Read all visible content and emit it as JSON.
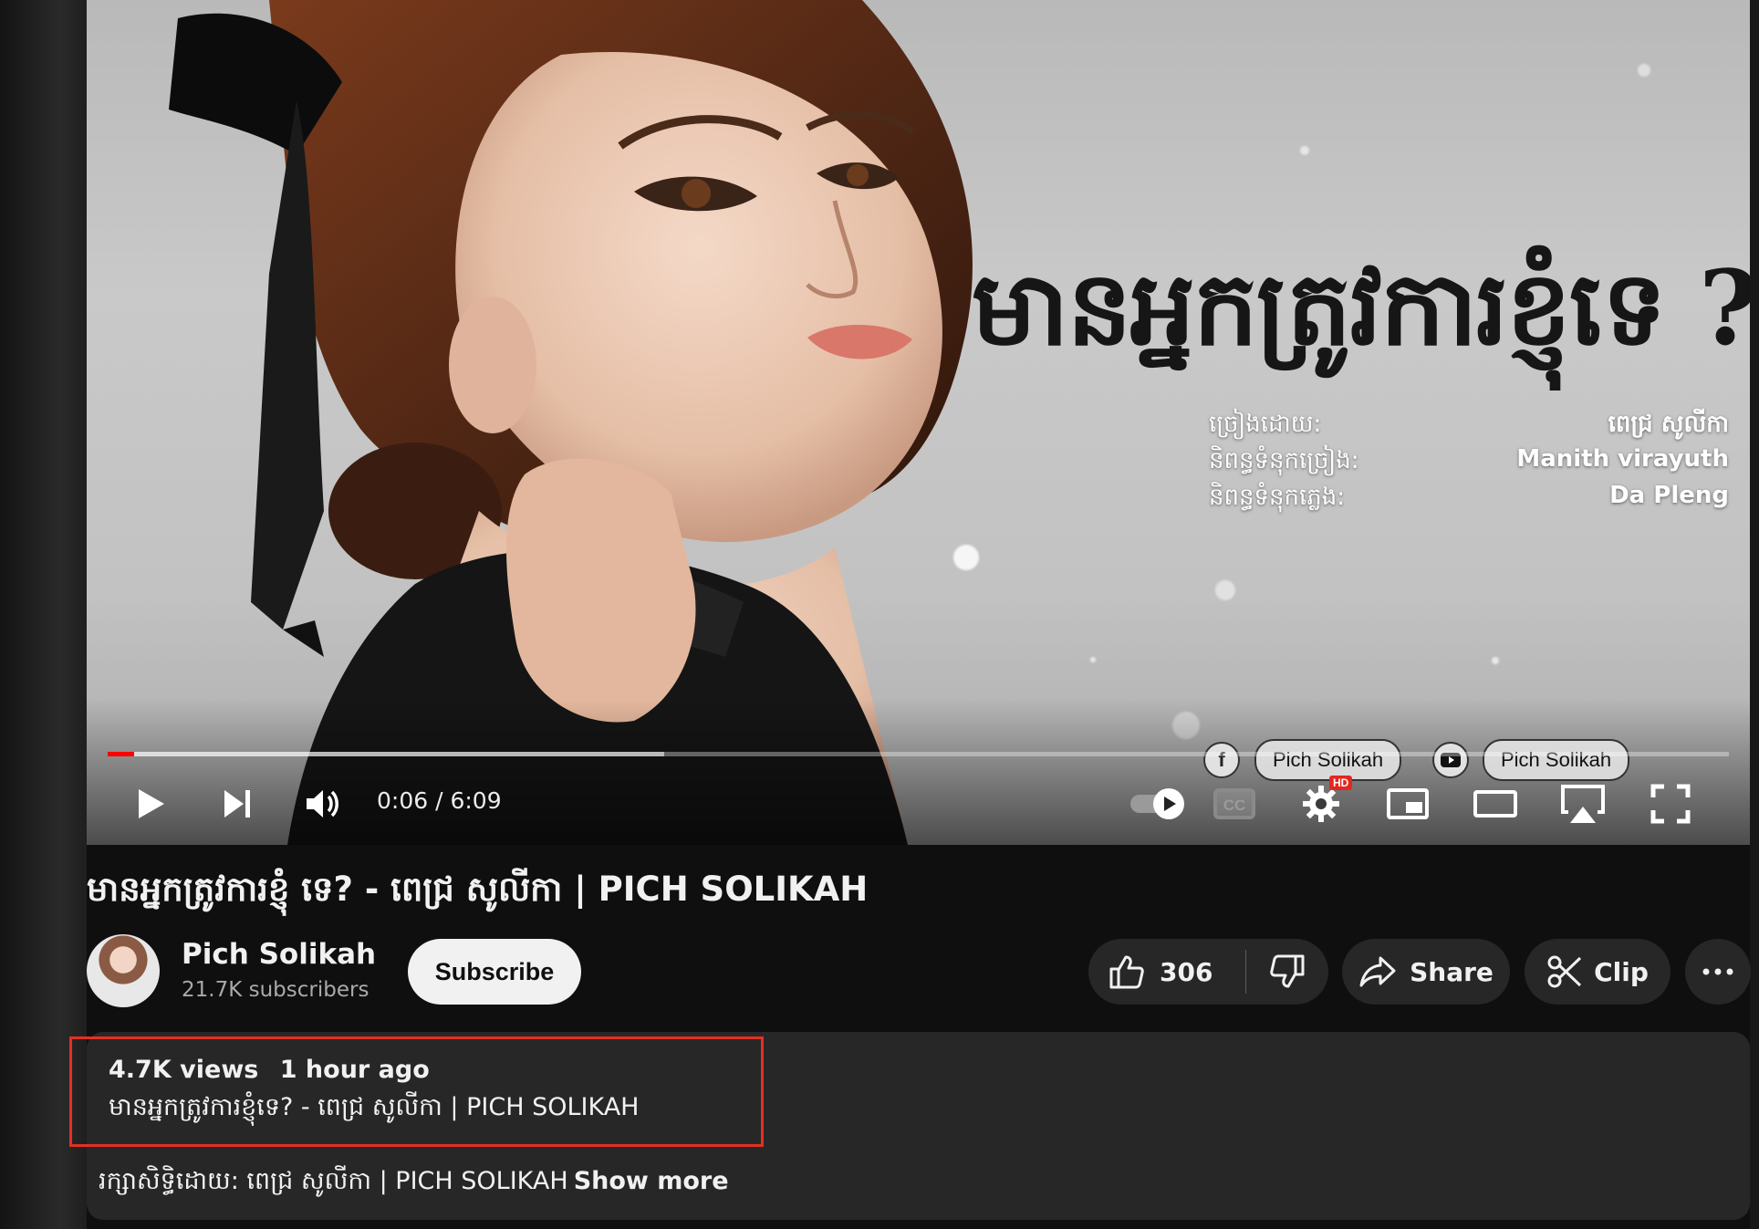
{
  "player": {
    "thumbnail_title": "មានអ្នកត្រូវការខ្ញុំទេ ?",
    "credits": [
      {
        "label": "ច្រៀងដោយ:",
        "value": "ពេជ្រ សូលីកា"
      },
      {
        "label": "និពន្ធទំនុកច្រៀង:",
        "value": "Manith virayuth"
      },
      {
        "label": "និពន្ធទំនុកភ្លេង:",
        "value": "Da Pleng"
      }
    ],
    "progress_fraction": 0.0163,
    "time_current": "0:06",
    "time_separator": " / ",
    "time_total": "6:09",
    "hd_badge": "HD",
    "cards": [
      "Pich Solikah",
      "Pich Solikah"
    ],
    "accent_color": "#ff0000"
  },
  "video": {
    "title": "មានអ្នកត្រូវការខ្ញុំ ទេ? - ពេជ្រ សូលីកា | PICH SOLIKAH"
  },
  "channel": {
    "name": "Pich Solikah",
    "subscribers": "21.7K subscribers",
    "subscribe_label": "Subscribe"
  },
  "actions": {
    "likes": "306",
    "share_label": "Share",
    "clip_label": "Clip"
  },
  "description": {
    "views": "4.7K views",
    "age": "1 hour ago",
    "title_line": "មានអ្នកត្រូវការខ្ញុំទេ? - ពេជ្រ សូលីកា | PICH SOLIKAH",
    "copyright_line": "រក្សាសិទ្ធិដោយ: ពេជ្រ សូលីកា | PICH SOLIKAH",
    "show_more": "Show more",
    "highlight_color": "#e33021"
  }
}
